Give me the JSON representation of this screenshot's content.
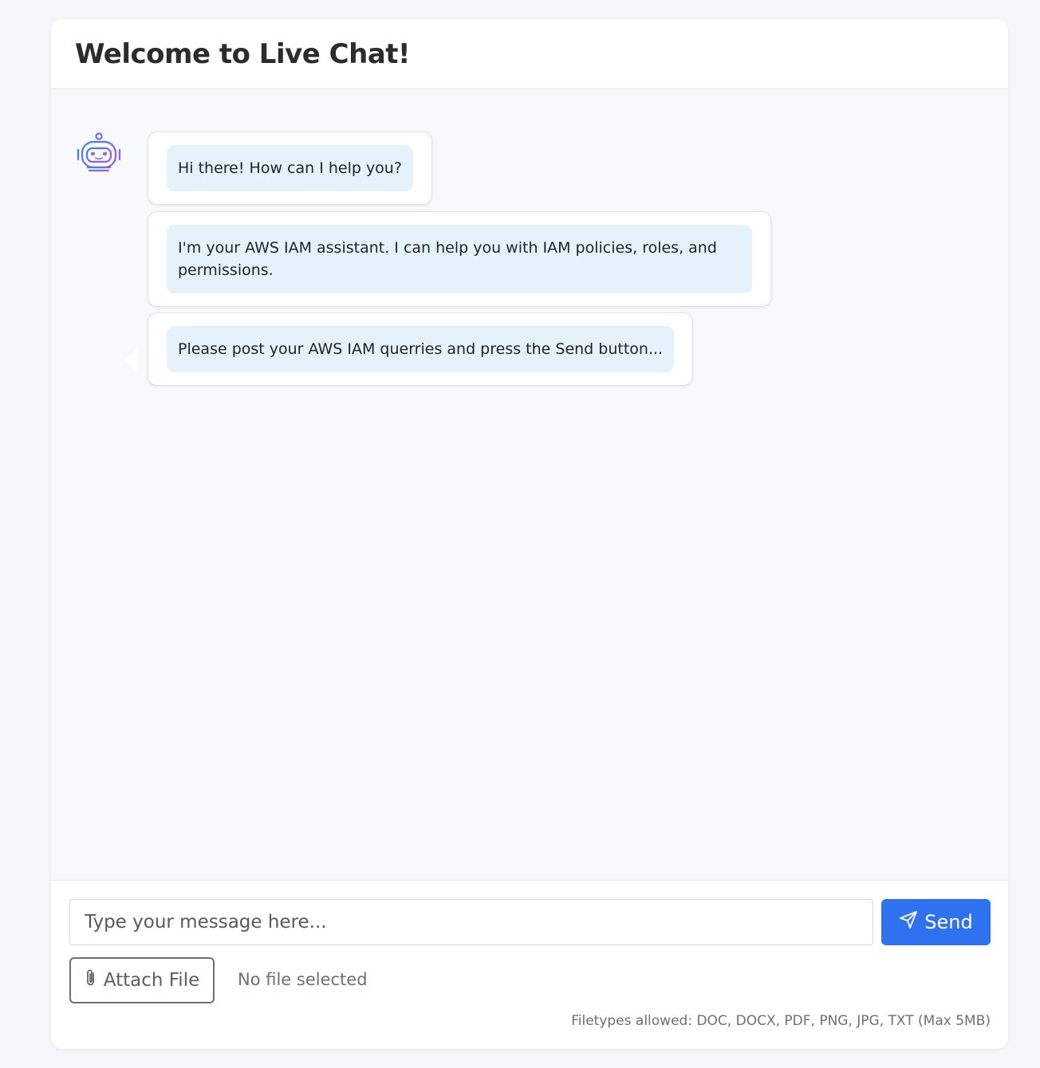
{
  "header": {
    "title": "Welcome to Live Chat!"
  },
  "messages": [
    {
      "text": "Hi there! How can I help you?"
    },
    {
      "text": "I'm your AWS IAM assistant. I can help you with IAM policies, roles, and permissions."
    },
    {
      "text": "Please post your AWS IAM querries and press the Send button..."
    }
  ],
  "composer": {
    "input_placeholder": "Type your message here...",
    "send_label": "Send",
    "attach_label": "Attach File",
    "file_status": "No file selected",
    "filetypes_note": "Filetypes allowed: DOC, DOCX, PDF, PNG, JPG, TXT (Max 5MB)"
  },
  "icons": {
    "avatar": "robot-icon",
    "send": "paper-plane-icon",
    "attach": "paperclip-icon"
  },
  "colors": {
    "accent": "#2f72f0",
    "bubble": "#e5f2fc",
    "avatar_gradient_start": "#3b82f6",
    "avatar_gradient_end": "#a855f7"
  }
}
